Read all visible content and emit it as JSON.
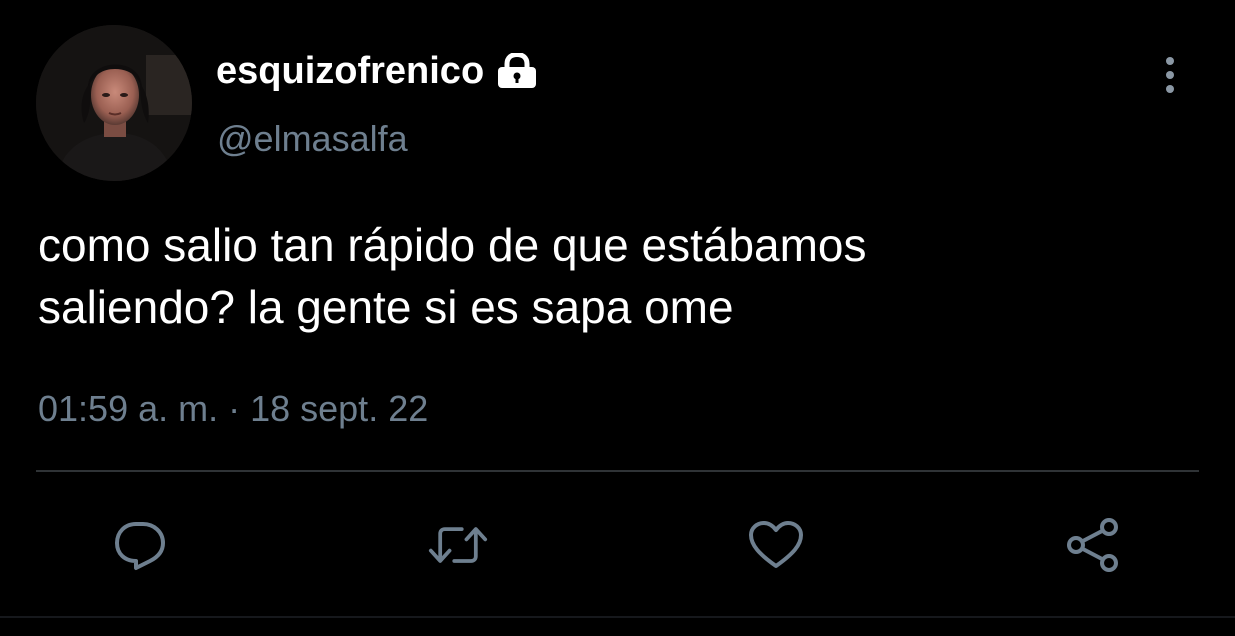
{
  "user": {
    "display_name": "esquizofrenico",
    "handle": "@elmasalfa",
    "avatar_icon": "profile-photo",
    "protected_icon": "lock-icon"
  },
  "tweet": {
    "text": "como salio tan rápido de que estábamos\nsaliendo? la gente si es sapa ome",
    "timestamp": "01:59 a. m. · 18 sept. 22"
  },
  "actions": [
    {
      "name": "reply",
      "icon": "reply-icon"
    },
    {
      "name": "retweet",
      "icon": "retweet-icon"
    },
    {
      "name": "like",
      "icon": "heart-icon"
    },
    {
      "name": "share",
      "icon": "share-icon"
    }
  ],
  "menu": {
    "icon": "more-vertical-icon"
  },
  "colors": {
    "background": "#000000",
    "text_primary": "#ffffff",
    "text_secondary": "#6e7f8f",
    "divider": "#2f3336"
  }
}
